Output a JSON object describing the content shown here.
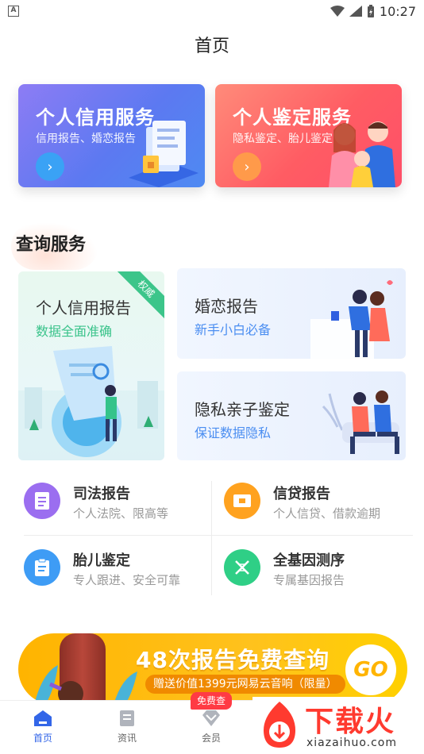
{
  "status_bar": {
    "time": "10:27",
    "notification_badge": "A"
  },
  "header": {
    "title": "首页"
  },
  "banners": [
    {
      "title": "个人信用服务",
      "subtitle": "信用报告、婚恋报告",
      "arrow": "›",
      "color": "#5c79f1"
    },
    {
      "title": "个人鉴定服务",
      "subtitle": "隐私鉴定、胎儿鉴定",
      "arrow": "›",
      "color": "#ff5c63"
    }
  ],
  "section": {
    "title": "查询服务"
  },
  "service_cards": [
    {
      "title": "个人信用报告",
      "subtitle": "数据全面准确",
      "ribbon": "权威"
    },
    {
      "title": "婚恋报告",
      "subtitle": "新手小白必备"
    },
    {
      "title": "隐私亲子鉴定",
      "subtitle": "保证数据隐私"
    }
  ],
  "reports": [
    {
      "title": "司法报告",
      "subtitle": "个人法院、限高等",
      "icon": "document-icon",
      "color": "#9b6ef0"
    },
    {
      "title": "信贷报告",
      "subtitle": "个人信贷、借款逾期",
      "icon": "card-icon",
      "color": "#ffa21f"
    },
    {
      "title": "胎儿鉴定",
      "subtitle": "专人跟进、安全可靠",
      "icon": "clipboard-icon",
      "color": "#3e9cf5"
    },
    {
      "title": "全基因测序",
      "subtitle": "专属基因报告",
      "icon": "dna-icon",
      "color": "#2fcf86"
    }
  ],
  "promo": {
    "title": "48次报告免费查询",
    "subtitle": "赠送价值1399元网易云音响（限量）",
    "go": "GO"
  },
  "bottom_nav": {
    "items": [
      {
        "label": "首页",
        "icon": "home-icon",
        "active": true
      },
      {
        "label": "资讯",
        "icon": "news-icon",
        "active": false
      },
      {
        "label": "会员",
        "icon": "vip-icon",
        "active": false
      }
    ],
    "badge": "免费查"
  },
  "watermark": {
    "text": "下载火",
    "url": "xiazaihuo.com"
  },
  "colors": {
    "accent": "#3366e8",
    "green": "#39c38a",
    "blue_sub": "#4b8ef1"
  }
}
